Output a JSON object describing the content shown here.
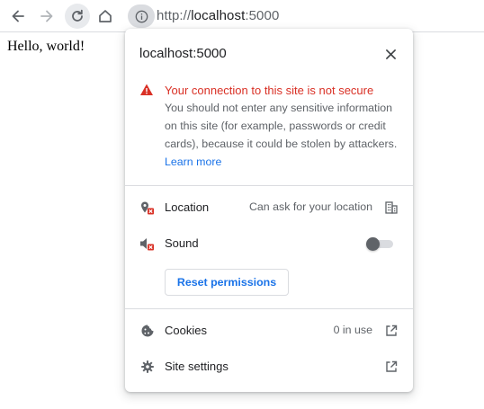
{
  "toolbar": {
    "url_scheme": "http://",
    "url_host": "localhost",
    "url_port": ":5000"
  },
  "page": {
    "content_text": "Hello, world!"
  },
  "popup": {
    "title": "localhost:5000",
    "warning_title": "Your connection to this site is not secure",
    "warning_body": "You should not enter any sensitive information on this site (for example, passwords or credit cards), because it could be stolen by attackers.",
    "learn_more_label": "Learn more",
    "permissions": [
      {
        "label": "Location",
        "value": "Can ask for your location",
        "icon": "location-blocked-icon"
      },
      {
        "label": "Sound",
        "value": "",
        "icon": "sound-blocked-icon",
        "toggle_on": false
      }
    ],
    "reset_label": "Reset permissions",
    "cookies_label": "Cookies",
    "cookies_value": "0 in use",
    "site_settings_label": "Site settings"
  },
  "colors": {
    "warning": "#d93025",
    "link": "#1a73e8",
    "text": "#202124",
    "secondary_text": "#5f6368"
  }
}
